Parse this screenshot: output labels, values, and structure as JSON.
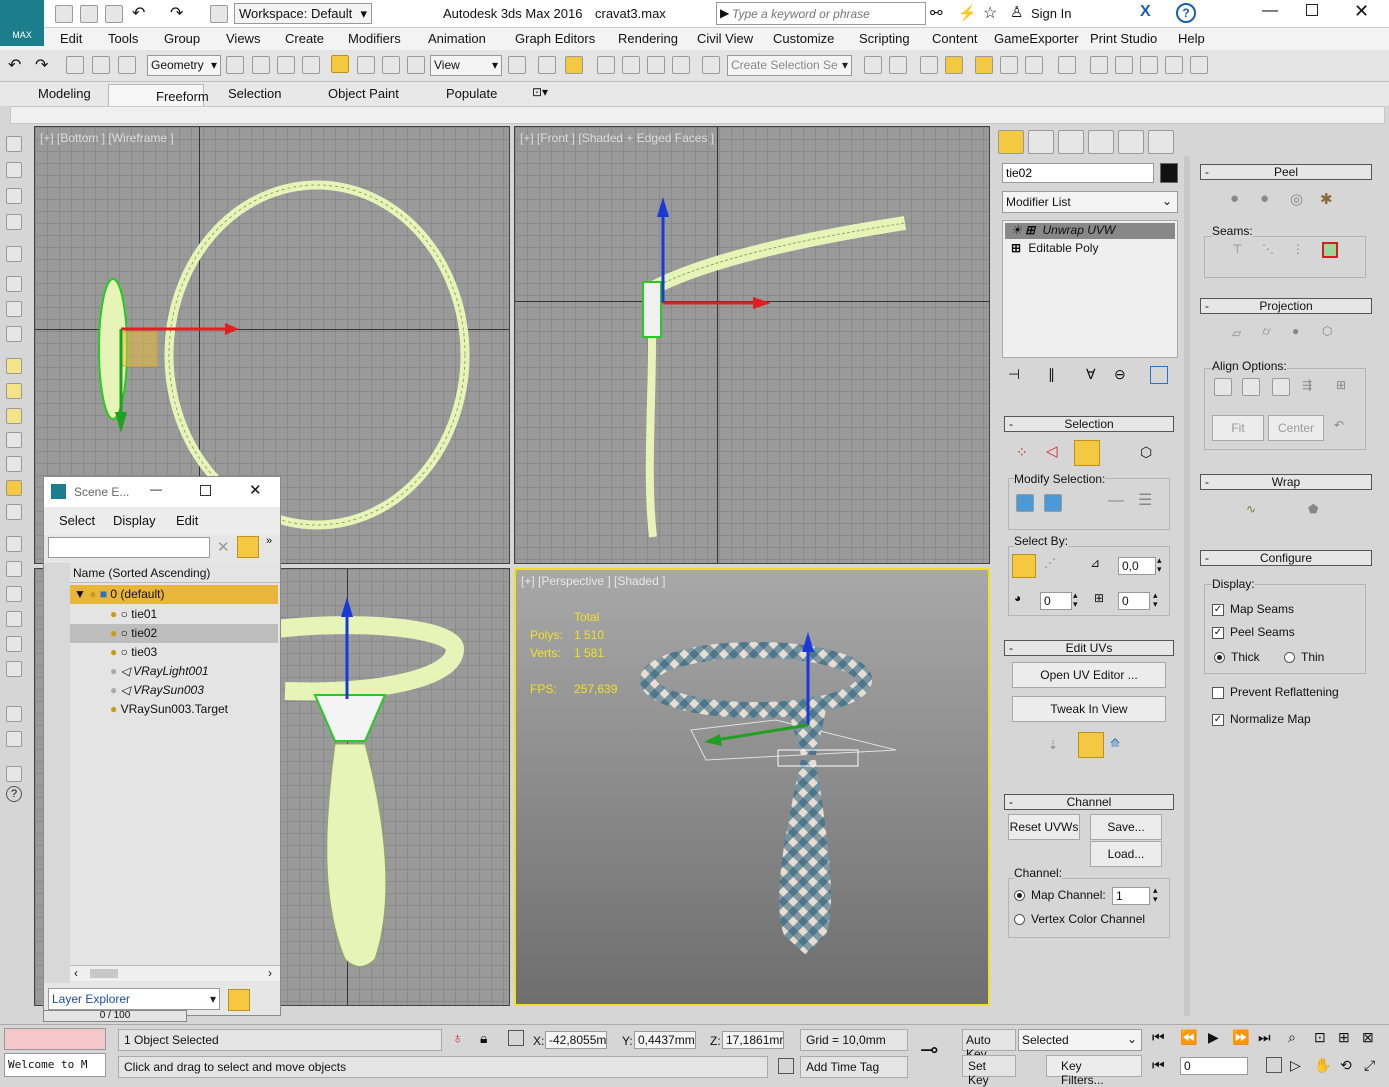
{
  "title": {
    "app": "Autodesk 3ds Max 2016",
    "file": "cravat3.max",
    "workspace": "Workspace: Default",
    "search_placeholder": "Type a keyword or phrase",
    "sign_in": "Sign In",
    "logo": "MAX"
  },
  "menu": [
    "Edit",
    "Tools",
    "Group",
    "Views",
    "Create",
    "Modifiers",
    "Animation",
    "Graph Editors",
    "Rendering",
    "Civil View",
    "Customize",
    "Scripting",
    "Content",
    "GameExporter",
    "Print Studio",
    "Help"
  ],
  "toolbar": {
    "filter": "Geometry",
    "refcoord": "View",
    "selection_set": "Create Selection Se"
  },
  "ribbon": [
    "Modeling",
    "Freeform",
    "Selection",
    "Object Paint",
    "Populate"
  ],
  "viewports": {
    "top_left": "[+] [Bottom ] [Wireframe ]",
    "top_right": "[+] [Front ] [Shaded + Edged Faces ]",
    "bottom_right": "[+] [Perspective ] [Shaded ]"
  },
  "stats": {
    "total_label": "Total",
    "polys_label": "Polys:",
    "polys": "1 510",
    "verts_label": "Verts:",
    "verts": "1 581",
    "fps_label": "FPS:",
    "fps": "257,639"
  },
  "scene_explorer": {
    "title": "Scene E...",
    "menu": [
      "Select",
      "Display",
      "Edit"
    ],
    "column": "Name (Sorted Ascending)",
    "items": [
      "0 (default)",
      "tie01",
      "tie02",
      "tie03",
      "VRayLight001",
      "VRaySun003",
      "VRaySun003.Target"
    ],
    "footer": "Layer Explorer"
  },
  "command_panel": {
    "object_name": "tie02",
    "modifier_list": "Modifier List",
    "stack": [
      "Unwrap UVW",
      "Editable Poly"
    ],
    "selection": {
      "title": "Selection",
      "modify": "Modify Selection:",
      "select_by": "Select By:",
      "angle": "0,0",
      "v1": "0",
      "v2": "0"
    },
    "edit_uvs": {
      "title": "Edit UVs",
      "open": "Open UV Editor ...",
      "tweak": "Tweak In View"
    },
    "channel": {
      "title": "Channel",
      "reset": "Reset UVWs",
      "save": "Save...",
      "load": "Load...",
      "channel_label": "Channel:",
      "map_channel": "Map Channel:",
      "map_value": "1",
      "vertex_color": "Vertex Color Channel"
    }
  },
  "unwrap_panel": {
    "peel": {
      "title": "Peel",
      "seams": "Seams:"
    },
    "projection": {
      "title": "Projection",
      "align": "Align Options:",
      "fit": "Fit",
      "center": "Center"
    },
    "wrap": {
      "title": "Wrap"
    },
    "configure": {
      "title": "Configure",
      "display": "Display:",
      "map_seams": "Map Seams",
      "peel_seams": "Peel Seams",
      "thick": "Thick",
      "thin": "Thin",
      "prevent": "Prevent Reflattening",
      "normalize": "Normalize Map"
    }
  },
  "status": {
    "selected": "1 Object Selected",
    "prompt": "Click and drag to select and move objects",
    "welcome": "Welcome to M",
    "x_label": "X:",
    "x": "-42,8055m",
    "y_label": "Y:",
    "y": "0,4437mm",
    "z_label": "Z:",
    "z": "17,1861mr",
    "grid": "Grid = 10,0mm",
    "add_time_tag": "Add Time Tag",
    "auto_key": "Auto Key",
    "set_key": "Set Key",
    "key_mode": "Selected",
    "key_filters": "Key Filters...",
    "frame": "0",
    "timeline": "0 / 100"
  }
}
